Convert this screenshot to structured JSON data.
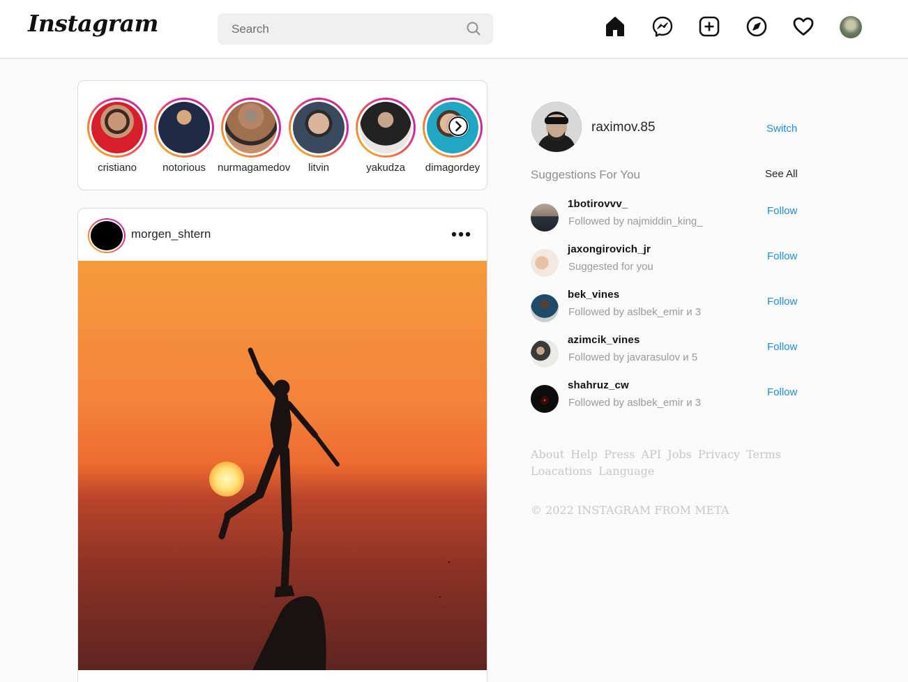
{
  "nav": {
    "logo": "Instagram",
    "search_placeholder": "Search"
  },
  "stories": [
    {
      "name": "cristiano"
    },
    {
      "name": "notorious"
    },
    {
      "name": "nurmagamedov"
    },
    {
      "name": "litvin"
    },
    {
      "name": "yakudza"
    },
    {
      "name": "dimagordey"
    }
  ],
  "post": {
    "username": "morgen_shtern"
  },
  "profile": {
    "username": "raximov.85",
    "switch_label": "Switch"
  },
  "suggestions": {
    "title": "Suggestions For You",
    "see_all": "See All",
    "follow_label": "Follow",
    "items": [
      {
        "username": "1botirovvv_",
        "subtitle": "Followed by najmiddin_king_"
      },
      {
        "username": "jaxongirovich_jr",
        "subtitle": "Suggested for you"
      },
      {
        "username": "bek_vines",
        "subtitle": "Followed by aslbek_emir и 3"
      },
      {
        "username": "azimcik_vines",
        "subtitle": "Followed by javarasulov и 5"
      },
      {
        "username": "shahruz_cw",
        "subtitle": "Followed by aslbek_emir и 3"
      }
    ]
  },
  "footer": {
    "links": [
      "About",
      "Help",
      "Press",
      "API",
      "Jobs",
      "Privacy",
      "Terms",
      "Loacations",
      "Language"
    ],
    "copyright": "© 2022 INSTAGRAM FROM META"
  },
  "colors": {
    "accent_blue": "#1a8fe0",
    "story_ring_start": "#f9c21d",
    "story_ring_end": "#c13584",
    "background": "#fafafa"
  }
}
